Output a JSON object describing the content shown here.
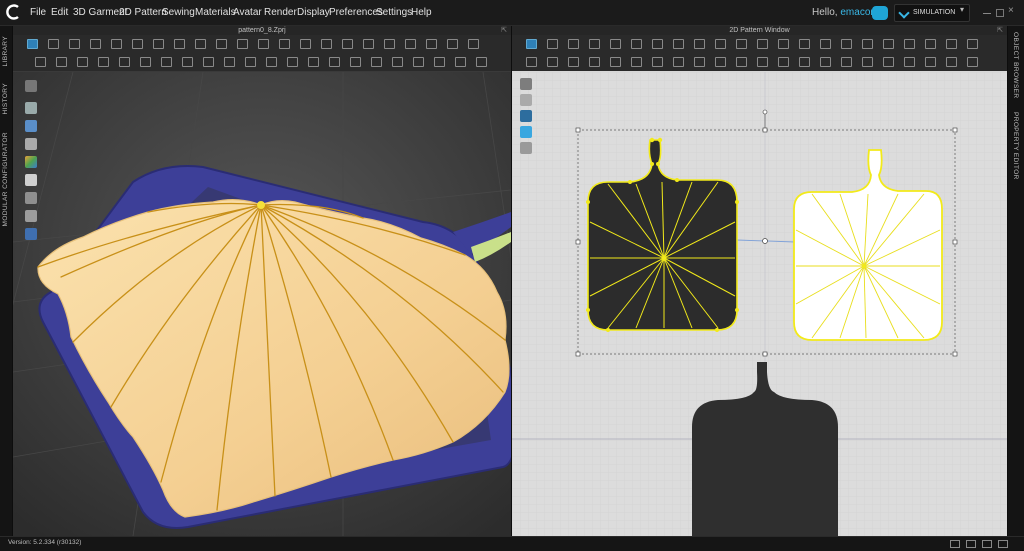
{
  "app": {
    "menu": [
      "File",
      "Edit",
      "3D Garment",
      "2D Pattern",
      "Sewing",
      "Materials",
      "Avatar",
      "Render",
      "Display",
      "Preferences",
      "Settings",
      "Help"
    ],
    "greeting": "Hello, ",
    "username": "emacorti",
    "simulation_label": "SIMULATION"
  },
  "left_tabs": [
    "LIBRARY",
    "HISTORY",
    "MODULAR CONFIGURATOR"
  ],
  "right_tabs": [
    "OBJECT BROWSER",
    "PROPERTY EDITOR"
  ],
  "window3d": {
    "title": "pattern0_8.Zprj",
    "colors": {
      "cloth": "#f7d59b",
      "seam": "#c89018",
      "board": "#3d3f98"
    }
  },
  "window2d": {
    "title": "2D Pattern Window",
    "colors": {
      "pattern_dark": "#2f2f2f",
      "pattern_selected": "#ffffff",
      "outline": "#f2ea1a"
    }
  },
  "status": {
    "version": "Version: 5.2.334 (r30132)"
  }
}
